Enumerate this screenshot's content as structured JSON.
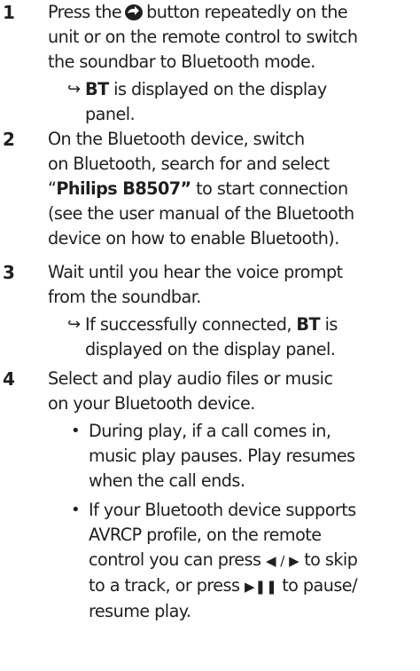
{
  "steps": [
    {
      "number": "1",
      "lines": [
        [
          "Press the",
          "button repeatedly on the"
        ],
        "unit or on the remote control to switch",
        "the soundbar to Bluetooth mode."
      ],
      "result": {
        "symbol": "↪",
        "strong": "BT",
        "line1_rest": " is displayed on the display",
        "line2": "panel."
      }
    },
    {
      "number": "2",
      "lines": [
        "On the Bluetooth device, switch",
        "on Bluetooth, search for and select",
        [
          "“",
          "Philips B8507”",
          " to start connection"
        ],
        "(see the user manual of the Bluetooth",
        "device on how to enable Bluetooth)."
      ]
    },
    {
      "number": "3",
      "lines": [
        "Wait until you hear the voice prompt",
        "from the soundbar."
      ],
      "result": {
        "symbol": "↪",
        "line1_pre": "If successfully connected, ",
        "strong": "BT",
        "line1_rest": " is",
        "line2": "displayed on the display panel."
      }
    },
    {
      "number": "4",
      "lines": [
        "Select and play audio files or music",
        "on your Bluetooth device."
      ],
      "bullets": [
        {
          "symbol": "•",
          "lines": [
            "During play, if a call comes in,",
            "music play pauses. Play resumes",
            "when the call ends."
          ]
        },
        {
          "symbol": "•",
          "lines": [
            "If your Bluetooth device supports",
            "AVRCP profile, on the remote",
            [
              "control you can press ",
              "◀ / ▶",
              " to skip"
            ],
            [
              "to a track, or press ",
              "▶❚❚",
              " to pause/"
            ],
            "resume play."
          ]
        }
      ]
    }
  ],
  "icons": {
    "source_button": "source-button-icon"
  }
}
